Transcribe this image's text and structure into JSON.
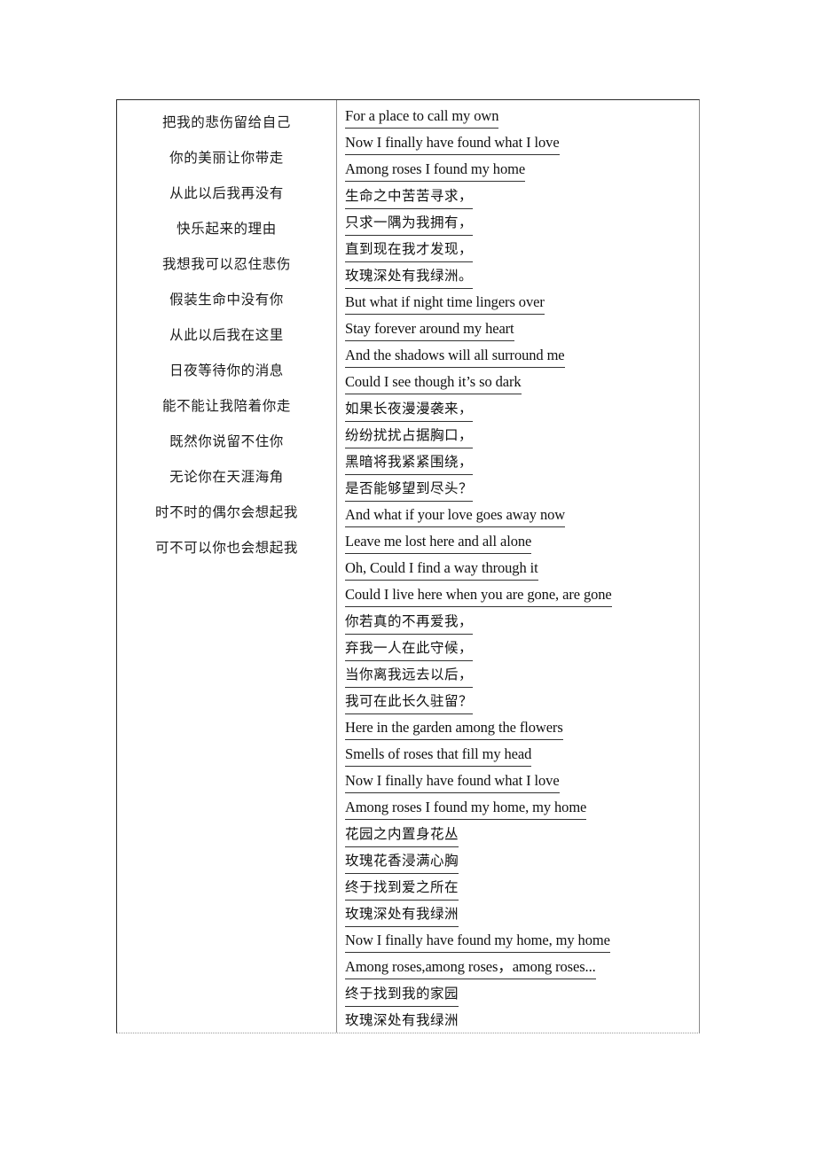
{
  "document": {
    "type": "lyrics-table",
    "page_background": "#ffffff",
    "border_color": "#2b2b2b",
    "inner_border_color": "#8a8a8a",
    "text_color": "#111111"
  },
  "table": {
    "left_column": {
      "name": "chinese-lyrics-column",
      "align": "center",
      "lines": [
        "把我的悲伤留给自己",
        "你的美丽让你带走",
        "从此以后我再没有",
        "快乐起来的理由",
        "我想我可以忍住悲伤",
        "假装生命中没有你",
        "从此以后我在这里",
        "日夜等待你的消息",
        "能不能让我陪着你走",
        "既然你说留不住你",
        "无论你在天涯海角",
        "时不时的偶尔会想起我",
        "可不可以你也会想起我"
      ]
    },
    "right_column": {
      "name": "bilingual-lyrics-column",
      "align": "left",
      "underlined": true,
      "lines": [
        {
          "lang": "en",
          "text": "For a place to call my own"
        },
        {
          "lang": "en",
          "text": "Now I finally have found what I love "
        },
        {
          "lang": "en",
          "text": "Among roses I found my home"
        },
        {
          "lang": "cn",
          "text": "生命之中苦苦寻求，"
        },
        {
          "lang": "cn",
          "text": "只求一隅为我拥有，"
        },
        {
          "lang": "cn",
          "text": "直到现在我才发现，"
        },
        {
          "lang": "cn",
          "text": "玫瑰深处有我绿洲。"
        },
        {
          "lang": "en",
          "text": "But what if night time lingers over "
        },
        {
          "lang": "en",
          "text": "Stay forever around my heart "
        },
        {
          "lang": "en",
          "text": "And the shadows will all surround me "
        },
        {
          "lang": "en",
          "text": "Could I see though it’s so dark "
        },
        {
          "lang": "cn",
          "text": "如果长夜漫漫袭来，"
        },
        {
          "lang": "cn",
          "text": "纷纷扰扰占据胸口，"
        },
        {
          "lang": "cn",
          "text": "黑暗将我紧紧围绕，"
        },
        {
          "lang": "cn",
          "text": "是否能够望到尽头？"
        },
        {
          "lang": "en",
          "text": "And what if your love goes away now "
        },
        {
          "lang": "en",
          "text": "Leave me lost here and all alone "
        },
        {
          "lang": "en",
          "text": "Oh, Could I find a way through it"
        },
        {
          "lang": "en",
          "text": "Could I live here when you are gone, are gone "
        },
        {
          "lang": "cn",
          "text": "你若真的不再爱我，"
        },
        {
          "lang": "cn",
          "text": "弃我一人在此守候，"
        },
        {
          "lang": "cn",
          "text": "当你离我远去以后，"
        },
        {
          "lang": "cn",
          "text": "我可在此长久驻留？"
        },
        {
          "lang": "en",
          "text": "Here in the garden among the flowers "
        },
        {
          "lang": "en",
          "text": "Smells of roses that fill my head "
        },
        {
          "lang": "en",
          "text": "Now I finally have found what I love "
        },
        {
          "lang": "en",
          "text": "Among roses I found my home, my home "
        },
        {
          "lang": "cn",
          "text": "花园之内置身花丛"
        },
        {
          "lang": "cn",
          "text": "玫瑰花香浸满心胸"
        },
        {
          "lang": "cn",
          "text": "终于找到爱之所在"
        },
        {
          "lang": "cn",
          "text": "玫瑰深处有我绿洲"
        },
        {
          "lang": "en",
          "text": "Now I finally have found my home, my home "
        },
        {
          "lang": "en",
          "text": "Among roses,among roses，among roses... "
        },
        {
          "lang": "cn",
          "text": "终于找到我的家园"
        },
        {
          "lang": "cn",
          "text": "玫瑰深处有我绿洲"
        }
      ]
    }
  }
}
